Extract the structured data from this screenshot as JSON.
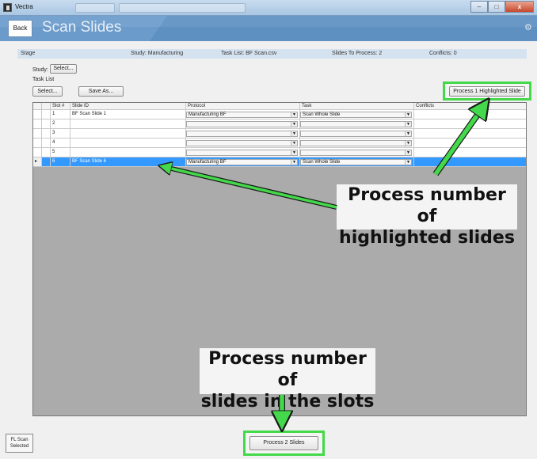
{
  "window": {
    "title": "Vectra",
    "minimize": "–",
    "maximize": "□",
    "close": "x"
  },
  "header": {
    "back_label": "Back",
    "title": "Scan Slides"
  },
  "infobar": {
    "stage": "Stage",
    "study": "Study: Manufacturing",
    "task_list": "Task List: BF Scan.csv",
    "slides_to_process": "Slides To Process: 2",
    "conflicts": "Conflicts: 0"
  },
  "controls": {
    "study_label": "Study:",
    "study_select": "Select...",
    "task_list_label": "Task List",
    "task_select": "Select...",
    "save_as": "Save As...",
    "process_highlighted": "Process 1 Highlighted Slide"
  },
  "grid": {
    "columns": [
      "Slot #",
      "Slide ID",
      "Protocol",
      "Task",
      "Conflicts"
    ],
    "rows": [
      {
        "slot": "1",
        "slide_id": "BF Scan Slide 1",
        "protocol": "Manufacturing BF",
        "task": "Scan Whole Slide",
        "conflicts": ""
      },
      {
        "slot": "2",
        "slide_id": "",
        "protocol": "",
        "task": "",
        "conflicts": ""
      },
      {
        "slot": "3",
        "slide_id": "",
        "protocol": "",
        "task": "",
        "conflicts": ""
      },
      {
        "slot": "4",
        "slide_id": "",
        "protocol": "",
        "task": "",
        "conflicts": ""
      },
      {
        "slot": "5",
        "slide_id": "",
        "protocol": "",
        "task": "",
        "conflicts": ""
      },
      {
        "slot": "6",
        "slide_id": "BF Scan Slide 6",
        "protocol": "Manufacturing BF",
        "task": "Scan Whole Slide",
        "conflicts": "",
        "selected": true
      }
    ],
    "row_marker": "▸",
    "dropdown_arrow": "▼"
  },
  "annotations": {
    "highlighted_line1": "Process number of",
    "highlighted_line2": "highlighted slides",
    "slots_line1": "Process number of",
    "slots_line2": "slides in the slots"
  },
  "footer": {
    "fl_scan_line1": "FL Scan",
    "fl_scan_line2": "Selected",
    "process_slides": "Process 2 Slides"
  },
  "colors": {
    "accent_green": "#43d94a",
    "selection_blue": "#3399ff",
    "header_blue": "#6a9bcb"
  },
  "icons": [
    "app-icon",
    "settings-gear-icon",
    "row-marker-icon",
    "dropdown-arrow-icon"
  ]
}
